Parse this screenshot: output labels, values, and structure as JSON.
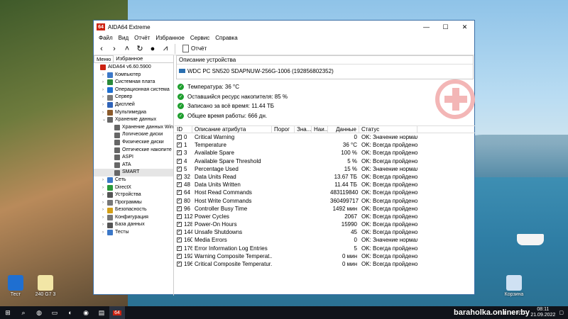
{
  "window": {
    "title": "AIDA64 Extreme",
    "logo": "64",
    "minimize": "—",
    "maximize": "☐",
    "close": "✕"
  },
  "menu": [
    "Файл",
    "Вид",
    "Отчёт",
    "Избранное",
    "Сервис",
    "Справка"
  ],
  "toolbar": {
    "report_label": "Отчёт"
  },
  "left_tabs": [
    "Меню",
    "Избранное"
  ],
  "tree": [
    {
      "label": "AIDA64 v6.60.5900",
      "indent": 0,
      "arrow": "",
      "color": "#c21"
    },
    {
      "label": "Компьютер",
      "indent": 1,
      "arrow": "›",
      "color": "#3c78c8"
    },
    {
      "label": "Системная плата",
      "indent": 1,
      "arrow": "›",
      "color": "#2a8a3a"
    },
    {
      "label": "Операционная система",
      "indent": 1,
      "arrow": "›",
      "color": "#1f6fd1"
    },
    {
      "label": "Сервер",
      "indent": 1,
      "arrow": "›",
      "color": "#7a7a7a"
    },
    {
      "label": "Дисплей",
      "indent": 1,
      "arrow": "›",
      "color": "#2f63b8"
    },
    {
      "label": "Мультимедиа",
      "indent": 1,
      "arrow": "›",
      "color": "#8b5a2b"
    },
    {
      "label": "Хранение данных",
      "indent": 1,
      "arrow": "⌄",
      "color": "#666"
    },
    {
      "label": "Хранение данных Win",
      "indent": 2,
      "arrow": "",
      "color": "#666"
    },
    {
      "label": "Логические диски",
      "indent": 2,
      "arrow": "",
      "color": "#666"
    },
    {
      "label": "Физические диски",
      "indent": 2,
      "arrow": "",
      "color": "#666"
    },
    {
      "label": "Оптические накопите",
      "indent": 2,
      "arrow": "",
      "color": "#666"
    },
    {
      "label": "ASPI",
      "indent": 2,
      "arrow": "",
      "color": "#666"
    },
    {
      "label": "ATA",
      "indent": 2,
      "arrow": "",
      "color": "#666"
    },
    {
      "label": "SMART",
      "indent": 2,
      "arrow": "",
      "color": "#666",
      "selected": true
    },
    {
      "label": "Сеть",
      "indent": 1,
      "arrow": "›",
      "color": "#3c78c8"
    },
    {
      "label": "DirectX",
      "indent": 1,
      "arrow": "›",
      "color": "#2a9a3a"
    },
    {
      "label": "Устройства",
      "indent": 1,
      "arrow": "›",
      "color": "#555"
    },
    {
      "label": "Программы",
      "indent": 1,
      "arrow": "›",
      "color": "#777"
    },
    {
      "label": "Безопасность",
      "indent": 1,
      "arrow": "›",
      "color": "#d4a017"
    },
    {
      "label": "Конфигурация",
      "indent": 1,
      "arrow": "›",
      "color": "#777"
    },
    {
      "label": "База данных",
      "indent": 1,
      "arrow": "›",
      "color": "#555"
    },
    {
      "label": "Тесты",
      "indent": 1,
      "arrow": "›",
      "color": "#3c78c8"
    }
  ],
  "device": {
    "header": "Описание устройства",
    "name": "WDC PC SN520 SDAPNUW-256G-1006 (192856802352)"
  },
  "summary": [
    "Температура: 36 °C",
    "Оставшийся ресурс накопителя: 85 %",
    "Записано за всё время: 11.44 ТБ",
    "Общее время работы: 666 дн."
  ],
  "table": {
    "headers": [
      "ID",
      "Описание атрибута",
      "Порог",
      "Зна...",
      "Наи...",
      "Данные",
      "Статус"
    ],
    "rows": [
      [
        "0",
        "Critical Warning",
        "",
        "",
        "",
        "0",
        "OK: Значение нормал..."
      ],
      [
        "1",
        "Temperature",
        "",
        "",
        "",
        "36 °C",
        "OK: Всегда пройдено"
      ],
      [
        "3",
        "Available Spare",
        "",
        "",
        "",
        "100 %",
        "OK: Всегда пройдено"
      ],
      [
        "4",
        "Available Spare Threshold",
        "",
        "",
        "",
        "5 %",
        "OK: Всегда пройдено"
      ],
      [
        "5",
        "Percentage Used",
        "",
        "",
        "",
        "15 %",
        "OK: Значение нормал..."
      ],
      [
        "32",
        "Data Units Read",
        "",
        "",
        "",
        "13.67 ТБ",
        "OK: Всегда пройдено"
      ],
      [
        "48",
        "Data Units Written",
        "",
        "",
        "",
        "11.44 ТБ",
        "OK: Всегда пройдено"
      ],
      [
        "64",
        "Host Read Commands",
        "",
        "",
        "",
        "483119840",
        "OK: Всегда пройдено"
      ],
      [
        "80",
        "Host Write Commands",
        "",
        "",
        "",
        "360499717",
        "OK: Всегда пройдено"
      ],
      [
        "96",
        "Controller Busy Time",
        "",
        "",
        "",
        "1492 мин",
        "OK: Всегда пройдено"
      ],
      [
        "112",
        "Power Cycles",
        "",
        "",
        "",
        "2067",
        "OK: Всегда пройдено"
      ],
      [
        "128",
        "Power-On Hours",
        "",
        "",
        "",
        "15990",
        "OK: Всегда пройдено"
      ],
      [
        "144",
        "Unsafe Shutdowns",
        "",
        "",
        "",
        "45",
        "OK: Всегда пройдено"
      ],
      [
        "160",
        "Media Errors",
        "",
        "",
        "",
        "0",
        "OK: Значение нормал..."
      ],
      [
        "176",
        "Error Information Log Entries",
        "",
        "",
        "",
        "5",
        "OK: Всегда пройдено"
      ],
      [
        "192",
        "Warning Composite Temperat...",
        "",
        "",
        "",
        "0 мин",
        "OK: Всегда пройдено"
      ],
      [
        "196",
        "Critical Composite Temperatur...",
        "",
        "",
        "",
        "0 мин",
        "OK: Всегда пройдено"
      ]
    ]
  },
  "desktop": {
    "icon1": "Тест",
    "icon2": "240 G7 3",
    "recycle": "Корзина"
  },
  "taskbar": {
    "lang": "РУС",
    "time": "08:11",
    "date": "21.09.2022",
    "app": "64"
  },
  "watermark": "baraholka.onliner.by"
}
